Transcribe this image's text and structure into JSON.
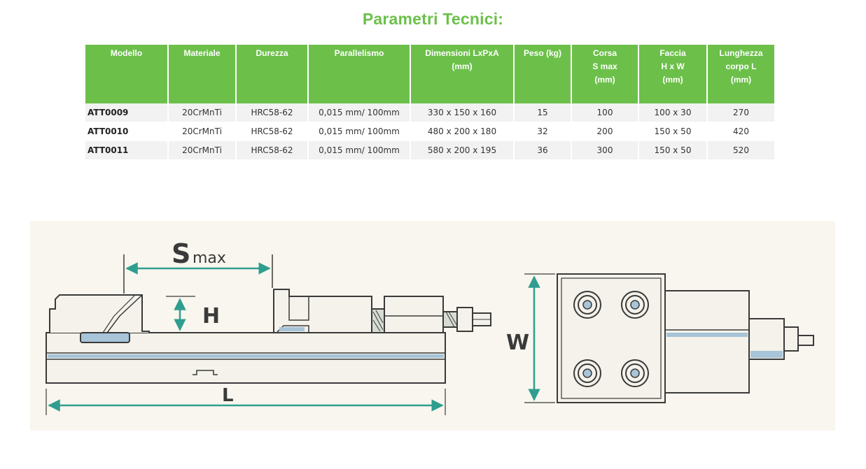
{
  "title": "Parametri Tecnici:",
  "table": {
    "headers": [
      "Modello",
      "Materiale",
      "Durezza",
      "Parallelismo",
      "Dimensioni LxPxA\n(mm)",
      "Peso (kg)",
      "Corsa\nS max\n(mm)",
      "Faccia\nH x W\n(mm)",
      "Lunghezza\ncorpo L\n(mm)"
    ],
    "rows": [
      [
        "ATT0009",
        "20CrMnTi",
        "HRC58-62",
        "0,015 mm/ 100mm",
        "330 x 150 x 160",
        "15",
        "100",
        "100 x 30",
        "270"
      ],
      [
        "ATT0010",
        "20CrMnTi",
        "HRC58-62",
        "0,015 mm/ 100mm",
        "480 x 200 x 180",
        "32",
        "200",
        "150 x 50",
        "420"
      ],
      [
        "ATT0011",
        "20CrMnTi",
        "HRC58-62",
        "0,015 mm/ 100mm",
        "580 x 200 x 195",
        "36",
        "300",
        "150 x 50",
        "520"
      ]
    ]
  },
  "diagram": {
    "label_s": "S",
    "label_max": "max",
    "label_h": "H",
    "label_l": "L",
    "label_w": "W",
    "colors": {
      "accent": "#2f9e8f",
      "line": "#3a3a3a",
      "steel": "#a7c4d8",
      "header_green": "#6cc04a"
    }
  }
}
